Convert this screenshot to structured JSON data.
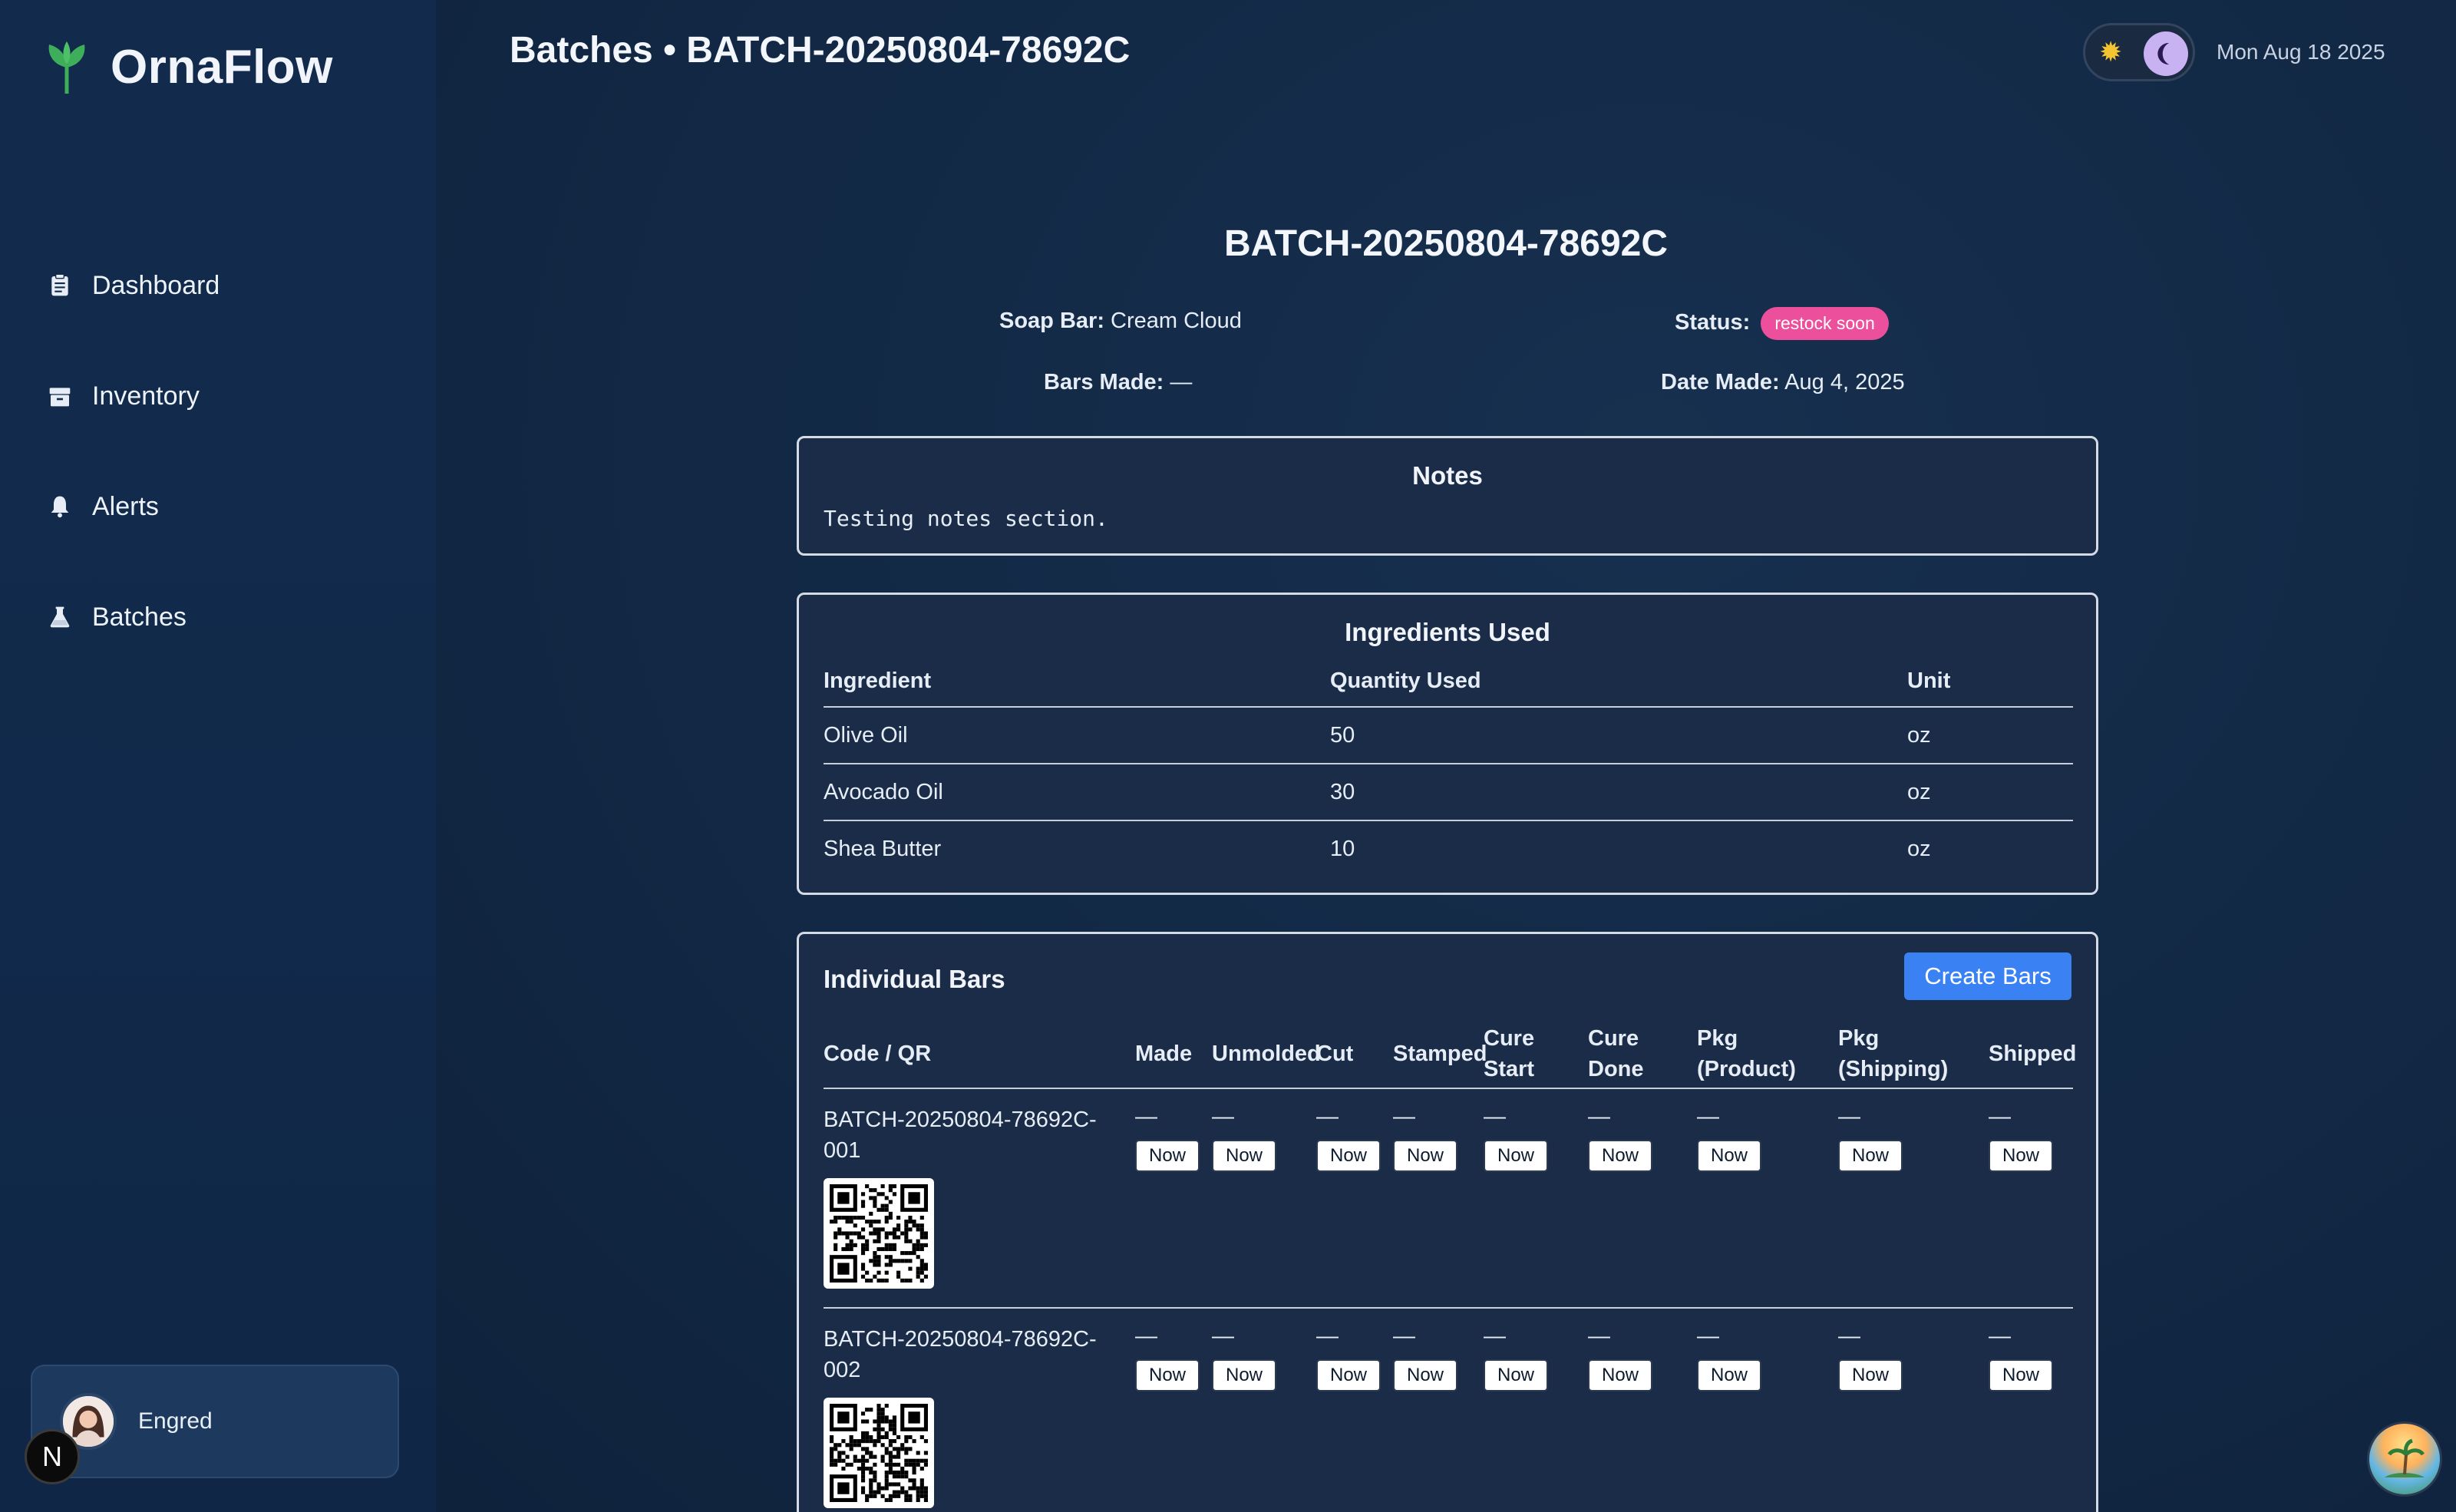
{
  "app": {
    "name": "OrnaFlow"
  },
  "nav": {
    "items": [
      {
        "label": "Dashboard",
        "icon": "clipboard-icon"
      },
      {
        "label": "Inventory",
        "icon": "box-icon"
      },
      {
        "label": "Alerts",
        "icon": "bell-icon"
      },
      {
        "label": "Batches",
        "icon": "flask-icon"
      }
    ]
  },
  "user": {
    "name": "Engred"
  },
  "badge": {
    "letter": "N"
  },
  "header": {
    "title": "Batches • BATCH-20250804-78692C",
    "date": "Mon Aug 18 2025"
  },
  "batch": {
    "code": "BATCH-20250804-78692C",
    "soap_bar_label": "Soap Bar:",
    "soap_bar": "Cream Cloud",
    "status_label": "Status:",
    "status": "restock soon",
    "status_color": "#ec4f9b",
    "bars_made_label": "Bars Made:",
    "bars_made": "—",
    "date_made_label": "Date Made:",
    "date_made": "Aug 4, 2025"
  },
  "notes": {
    "title": "Notes",
    "text": "Testing notes section."
  },
  "ingredients": {
    "title": "Ingredients Used",
    "headers": [
      "Ingredient",
      "Quantity Used",
      "Unit"
    ],
    "rows": [
      [
        "Olive Oil",
        "50",
        "oz"
      ],
      [
        "Avocado Oil",
        "30",
        "oz"
      ],
      [
        "Shea Butter",
        "10",
        "oz"
      ]
    ]
  },
  "bars": {
    "title": "Individual Bars",
    "create_label": "Create Bars",
    "accent": "#3a82f3",
    "headers": [
      "Code / QR",
      "Made",
      "Unmolded",
      "Cut",
      "Stamped",
      "Cure Start",
      "Cure Done",
      "Pkg (Product)",
      "Pkg (Shipping)",
      "Shipped"
    ],
    "now_label": "Now",
    "rows": [
      {
        "code": "BATCH-20250804-78692C-001",
        "values": [
          "—",
          "—",
          "—",
          "—",
          "—",
          "—",
          "—",
          "—",
          "—"
        ]
      },
      {
        "code": "BATCH-20250804-78692C-002",
        "values": [
          "—",
          "—",
          "—",
          "—",
          "—",
          "—",
          "—",
          "—",
          "—"
        ]
      }
    ]
  }
}
